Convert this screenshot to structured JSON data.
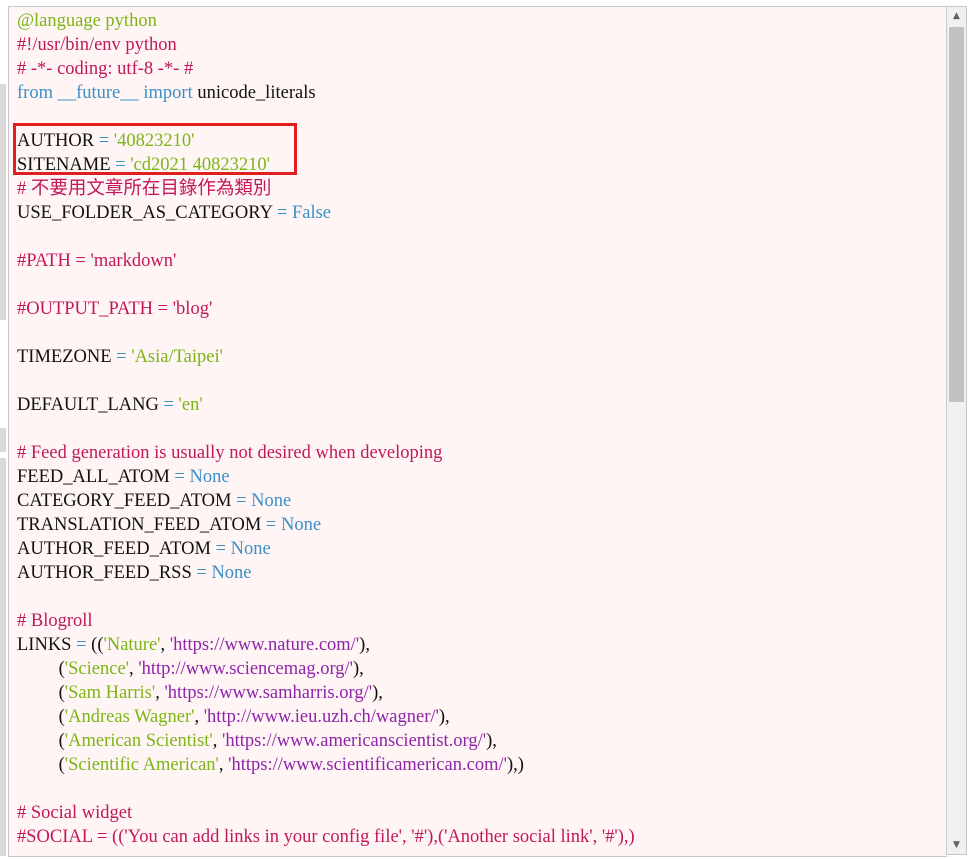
{
  "editor": {
    "lines": [
      [
        {
          "t": "@language python",
          "c": "dec"
        }
      ],
      [
        {
          "t": "#!/usr/bin/env python",
          "c": "cmt"
        }
      ],
      [
        {
          "t": "# -*- coding: utf-8 -*- #",
          "c": "cmt"
        }
      ],
      [
        {
          "t": "from",
          "c": "kw"
        },
        {
          "t": " __future__ ",
          "c": "kw"
        },
        {
          "t": "import",
          "c": "kw"
        },
        {
          "t": " unicode_literals",
          "c": "id"
        }
      ],
      [],
      [
        {
          "t": "AUTHOR",
          "c": "id"
        },
        {
          "t": " = ",
          "c": "op"
        },
        {
          "t": "'40823210'",
          "c": "str"
        }
      ],
      [
        {
          "t": "SITENAME",
          "c": "id"
        },
        {
          "t": " = ",
          "c": "op"
        },
        {
          "t": "'cd2021 40823210'",
          "c": "str"
        }
      ],
      [
        {
          "t": "# 不要用文章所在目錄作為類別",
          "c": "cmt"
        }
      ],
      [
        {
          "t": "USE_FOLDER_AS_CATEGORY",
          "c": "id"
        },
        {
          "t": " = ",
          "c": "op"
        },
        {
          "t": "False",
          "c": "kw"
        }
      ],
      [],
      [
        {
          "t": "#PATH = 'markdown'",
          "c": "cmt"
        }
      ],
      [],
      [
        {
          "t": "#OUTPUT_PATH = 'blog'",
          "c": "cmt"
        }
      ],
      [],
      [
        {
          "t": "TIMEZONE",
          "c": "id"
        },
        {
          "t": " = ",
          "c": "op"
        },
        {
          "t": "'Asia/Taipei'",
          "c": "str"
        }
      ],
      [],
      [
        {
          "t": "DEFAULT_LANG",
          "c": "id"
        },
        {
          "t": " = ",
          "c": "op"
        },
        {
          "t": "'en'",
          "c": "str"
        }
      ],
      [],
      [
        {
          "t": "# Feed generation is usually not desired when developing",
          "c": "cmt"
        }
      ],
      [
        {
          "t": "FEED_ALL_ATOM",
          "c": "id"
        },
        {
          "t": " = ",
          "c": "op"
        },
        {
          "t": "None",
          "c": "kw"
        }
      ],
      [
        {
          "t": "CATEGORY_FEED_ATOM",
          "c": "id"
        },
        {
          "t": " = ",
          "c": "op"
        },
        {
          "t": "None",
          "c": "kw"
        }
      ],
      [
        {
          "t": "TRANSLATION_FEED_ATOM",
          "c": "id"
        },
        {
          "t": " = ",
          "c": "op"
        },
        {
          "t": "None",
          "c": "kw"
        }
      ],
      [
        {
          "t": "AUTHOR_FEED_ATOM",
          "c": "id"
        },
        {
          "t": " = ",
          "c": "op"
        },
        {
          "t": "None",
          "c": "kw"
        }
      ],
      [
        {
          "t": "AUTHOR_FEED_RSS",
          "c": "id"
        },
        {
          "t": " = ",
          "c": "op"
        },
        {
          "t": "None",
          "c": "kw"
        }
      ],
      [],
      [
        {
          "t": "# Blogroll",
          "c": "cmt"
        }
      ],
      [
        {
          "t": "LINKS",
          "c": "id"
        },
        {
          "t": " = ",
          "c": "op"
        },
        {
          "t": "((",
          "c": "id"
        },
        {
          "t": "'Nature'",
          "c": "str"
        },
        {
          "t": ", ",
          "c": "id"
        },
        {
          "t": "'https://www.nature.com/'",
          "c": "url"
        },
        {
          "t": "),",
          "c": "id"
        }
      ],
      [
        {
          "t": "         (",
          "c": "id"
        },
        {
          "t": "'Science'",
          "c": "str"
        },
        {
          "t": ", ",
          "c": "id"
        },
        {
          "t": "'http://www.sciencemag.org/'",
          "c": "url"
        },
        {
          "t": "),",
          "c": "id"
        }
      ],
      [
        {
          "t": "         (",
          "c": "id"
        },
        {
          "t": "'Sam Harris'",
          "c": "str"
        },
        {
          "t": ", ",
          "c": "id"
        },
        {
          "t": "'https://www.samharris.org/'",
          "c": "url"
        },
        {
          "t": "),",
          "c": "id"
        }
      ],
      [
        {
          "t": "         (",
          "c": "id"
        },
        {
          "t": "'Andreas Wagner'",
          "c": "str"
        },
        {
          "t": ", ",
          "c": "id"
        },
        {
          "t": "'http://www.ieu.uzh.ch/wagner/'",
          "c": "url"
        },
        {
          "t": "),",
          "c": "id"
        }
      ],
      [
        {
          "t": "         (",
          "c": "id"
        },
        {
          "t": "'American Scientist'",
          "c": "str"
        },
        {
          "t": ", ",
          "c": "id"
        },
        {
          "t": "'https://www.americanscientist.org/'",
          "c": "url"
        },
        {
          "t": "),",
          "c": "id"
        }
      ],
      [
        {
          "t": "         (",
          "c": "id"
        },
        {
          "t": "'Scientific American'",
          "c": "str"
        },
        {
          "t": ", ",
          "c": "id"
        },
        {
          "t": "'https://www.scientificamerican.com/'",
          "c": "url"
        },
        {
          "t": "),)",
          "c": "id"
        }
      ],
      [],
      [
        {
          "t": "# Social widget",
          "c": "cmt"
        }
      ],
      [
        {
          "t": "#SOCIAL = (('You can add links in your config file', '#'),('Another social link', '#'),)",
          "c": "cmt"
        }
      ]
    ]
  },
  "scrollbar": {
    "up_icon": "scroll-up-arrow-icon",
    "down_icon": "scroll-down-arrow-icon",
    "up_glyph": "▲",
    "down_glyph": "▼"
  },
  "colors": {
    "editor_background": "#fff5f5",
    "keyword": "#3c8fc6",
    "string": "#7cb518",
    "comment": "#c2185b",
    "url": "#8e24aa",
    "highlight_border": "#e02020"
  }
}
